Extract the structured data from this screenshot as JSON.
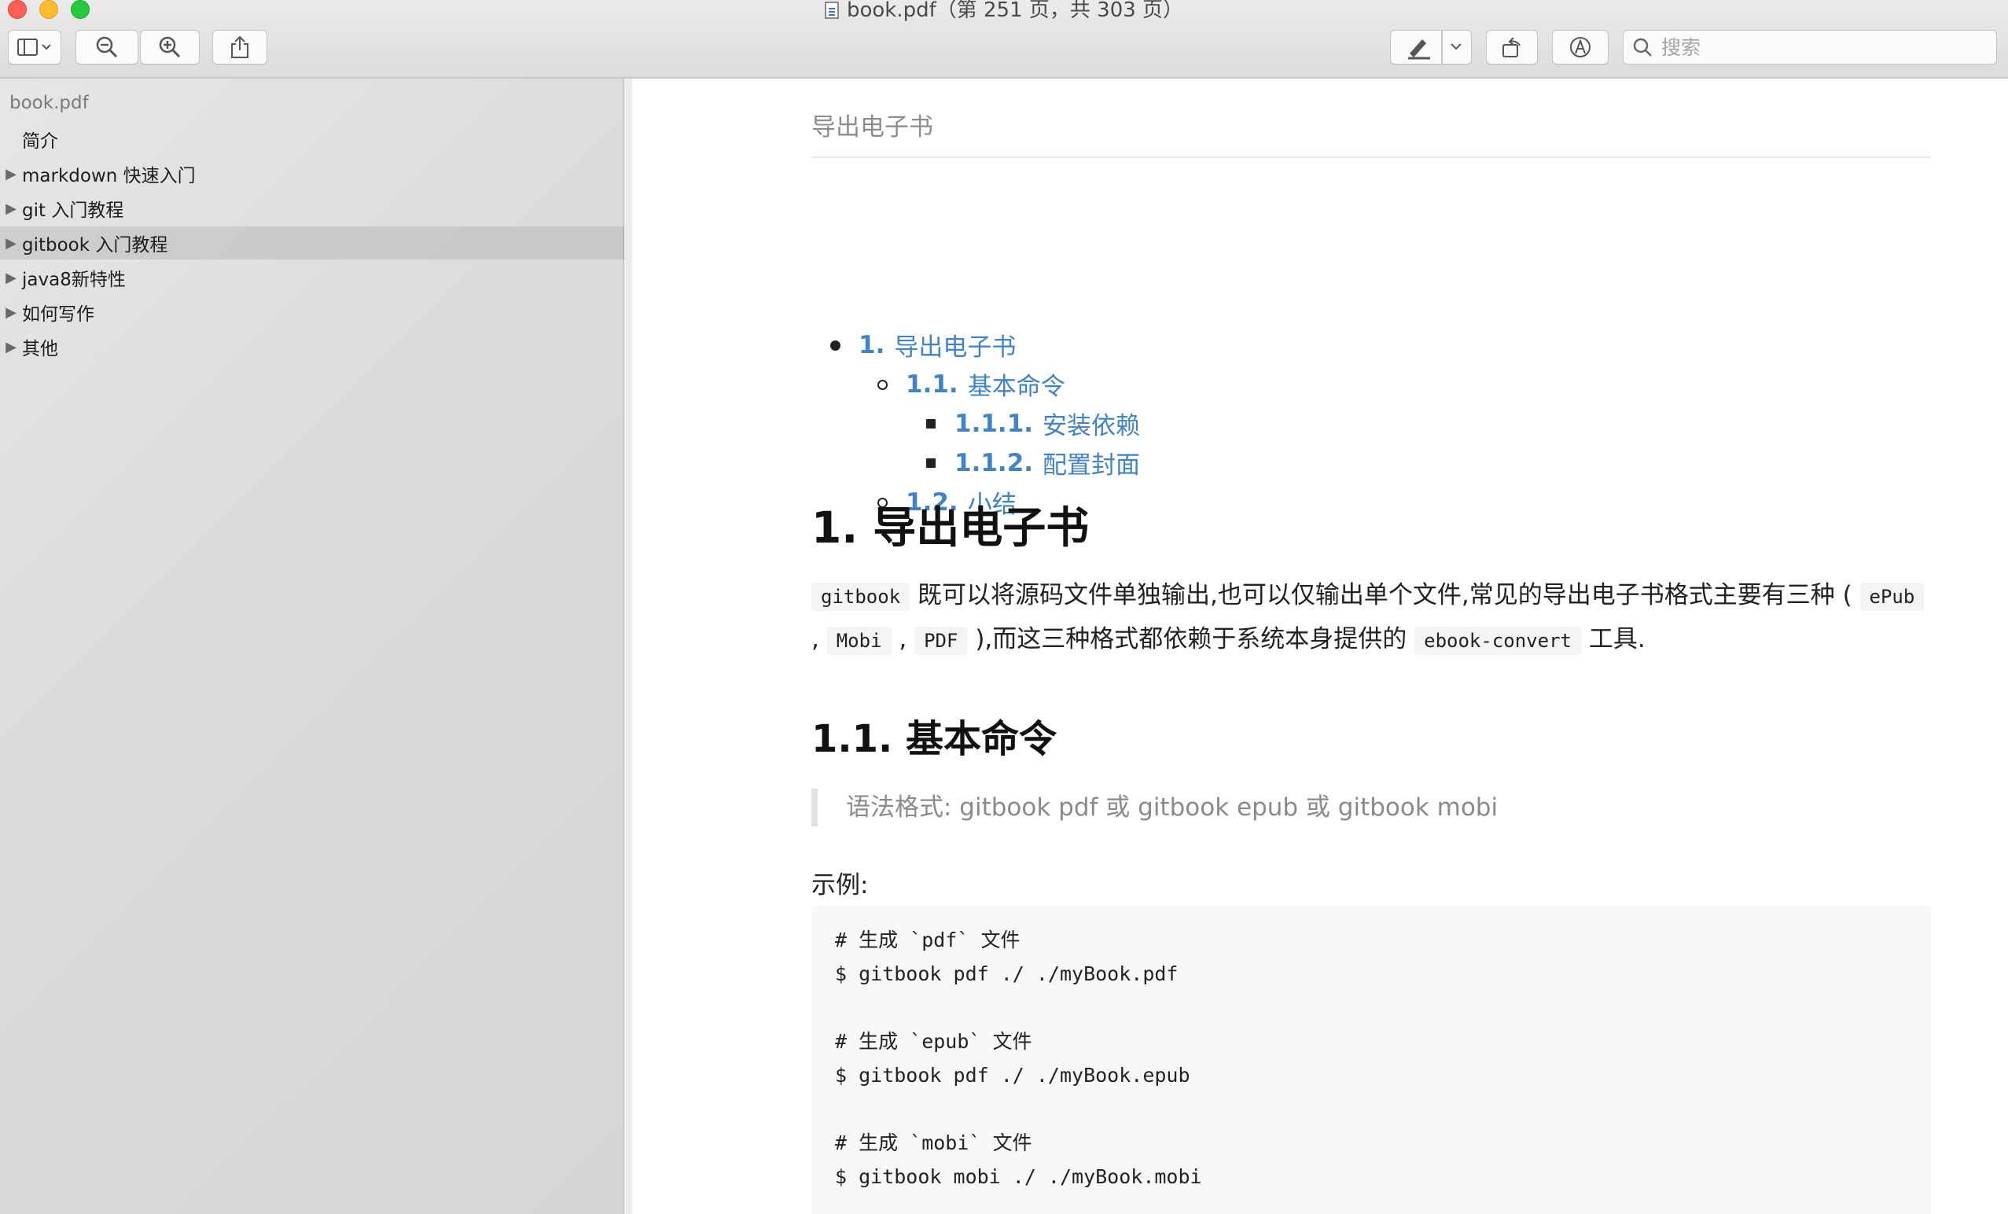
{
  "window": {
    "title": "book.pdf（第 251 页，共 303 页）"
  },
  "toolbar": {
    "sidebar_toggle_icon": "sidebar-icon",
    "zoom_out_icon": "zoom-out-icon",
    "zoom_in_icon": "zoom-in-icon",
    "share_icon": "share-icon",
    "highlight_icon": "pen-icon",
    "rotate_icon": "rotate-icon",
    "markup_icon": "markup-icon",
    "search_placeholder": "搜索"
  },
  "sidebar": {
    "root": "book.pdf",
    "items": [
      {
        "label": "简介",
        "expandable": false
      },
      {
        "label": "markdown 快速入门",
        "expandable": true
      },
      {
        "label": "git 入门教程",
        "expandable": true
      },
      {
        "label": "gitbook 入门教程",
        "expandable": true,
        "selected": true
      },
      {
        "label": "java8新特性",
        "expandable": true
      },
      {
        "label": "如何写作",
        "expandable": true
      },
      {
        "label": "其他",
        "expandable": true
      }
    ]
  },
  "page": {
    "running_head": "导出电子书",
    "toc": [
      {
        "num": "1.",
        "text": "导出电子书"
      },
      {
        "num": "1.1.",
        "text": "基本命令"
      },
      {
        "num": "1.1.1.",
        "text": "安装依赖"
      },
      {
        "num": "1.1.2.",
        "text": "配置封面"
      },
      {
        "num": "1.2.",
        "text": "小结"
      }
    ],
    "h1": "1. 导出电子书",
    "para": {
      "code1": "gitbook",
      "text1": "既可以将源码文件单独输出,也可以仅输出单个文件,常见的导出电子书格式主要有三种 (",
      "code2": "ePub",
      "sep1": ",",
      "code3": "Mobi",
      "sep2": ",",
      "code4": "PDF",
      "text2": "),而这三种格式都依赖于系统本身提供的",
      "code5": "ebook-convert",
      "text3": "工具."
    },
    "h2": "1.1. 基本命令",
    "quote": "语法格式: gitbook pdf 或 gitbook epub 或 gitbook mobi",
    "example_label": "示例:",
    "code_lines": [
      "# 生成 `pdf` 文件",
      "$ gitbook pdf ./ ./myBook.pdf",
      "",
      "# 生成 `epub` 文件",
      "$ gitbook pdf ./ ./myBook.epub",
      "",
      "# 生成 `mobi` 文件",
      "$ gitbook mobi ./ ./myBook.mobi"
    ]
  }
}
